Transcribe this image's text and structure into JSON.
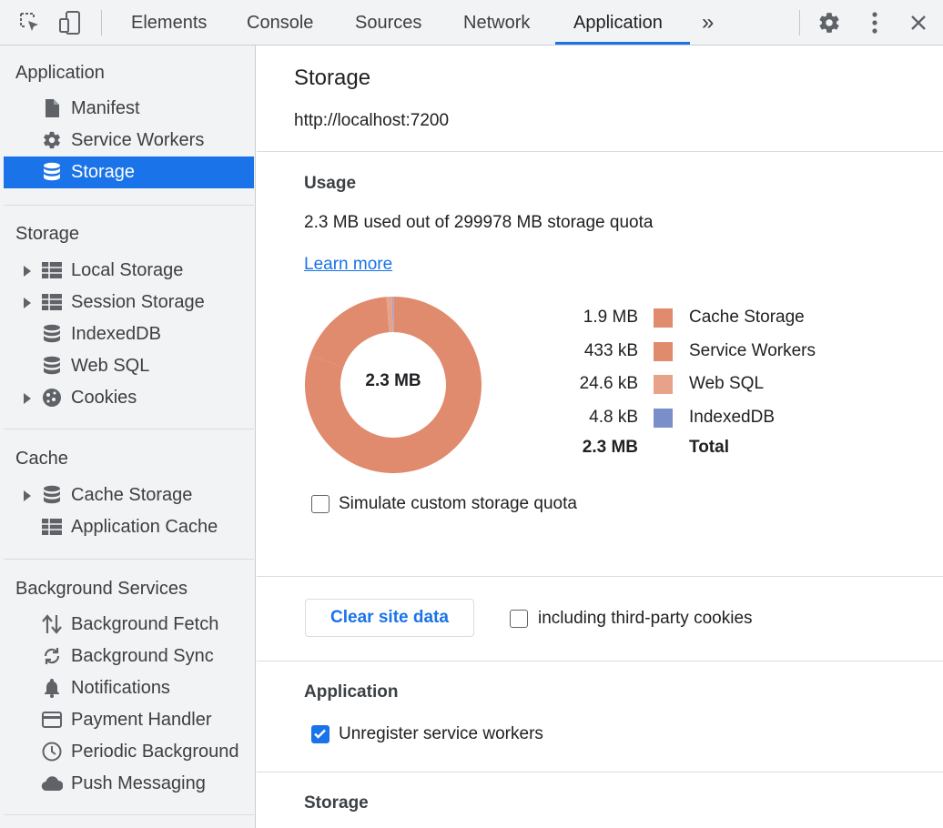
{
  "toolbar": {
    "tabs": [
      "Elements",
      "Console",
      "Sources",
      "Network",
      "Application"
    ],
    "active_tab": "Application",
    "overflow_label": "»"
  },
  "sidebar": {
    "sections": [
      {
        "title": "Application",
        "items": [
          {
            "label": "Manifest",
            "icon": "document-icon"
          },
          {
            "label": "Service Workers",
            "icon": "gear-icon"
          },
          {
            "label": "Storage",
            "icon": "database-icon",
            "selected": true
          }
        ]
      },
      {
        "title": "Storage",
        "items": [
          {
            "label": "Local Storage",
            "icon": "table-icon",
            "expandable": true
          },
          {
            "label": "Session Storage",
            "icon": "table-icon",
            "expandable": true
          },
          {
            "label": "IndexedDB",
            "icon": "database-icon"
          },
          {
            "label": "Web SQL",
            "icon": "database-icon"
          },
          {
            "label": "Cookies",
            "icon": "cookie-icon",
            "expandable": true
          }
        ]
      },
      {
        "title": "Cache",
        "items": [
          {
            "label": "Cache Storage",
            "icon": "database-icon",
            "expandable": true
          },
          {
            "label": "Application Cache",
            "icon": "table-icon"
          }
        ]
      },
      {
        "title": "Background Services",
        "items": [
          {
            "label": "Background Fetch",
            "icon": "up-down-arrows-icon"
          },
          {
            "label": "Background Sync",
            "icon": "sync-icon"
          },
          {
            "label": "Notifications",
            "icon": "bell-icon"
          },
          {
            "label": "Payment Handler",
            "icon": "credit-card-icon"
          },
          {
            "label": "Periodic Background",
            "icon": "clock-icon"
          },
          {
            "label": "Push Messaging",
            "icon": "cloud-icon"
          }
        ]
      }
    ]
  },
  "main": {
    "title": "Storage",
    "origin": "http://localhost:7200",
    "usage": {
      "heading": "Usage",
      "text": "2.3 MB used out of 299978 MB storage quota",
      "learn_more": "Learn more",
      "donut_center": "2.3 MB",
      "legend": [
        {
          "value": "1.9 MB",
          "name": "Cache Storage",
          "color": "#e08a6e",
          "kb": 1900
        },
        {
          "value": "433 kB",
          "name": "Service Workers",
          "color": "#e08a6e",
          "kb": 433
        },
        {
          "value": "24.6 kB",
          "name": "Web SQL",
          "color": "#e8a28a",
          "kb": 24.6
        },
        {
          "value": "4.8 kB",
          "name": "IndexedDB",
          "color": "#7a8fc9",
          "kb": 4.8
        }
      ],
      "total": {
        "value": "2.3 MB",
        "name": "Total"
      },
      "simulate_quota": {
        "label": "Simulate custom storage quota",
        "checked": false
      }
    },
    "clear": {
      "button": "Clear site data",
      "third_party": {
        "label": "including third-party cookies",
        "checked": false
      }
    },
    "application_section": {
      "heading": "Application",
      "unregister": {
        "label": "Unregister service workers",
        "checked": true
      }
    },
    "storage_section": {
      "heading": "Storage"
    }
  }
}
